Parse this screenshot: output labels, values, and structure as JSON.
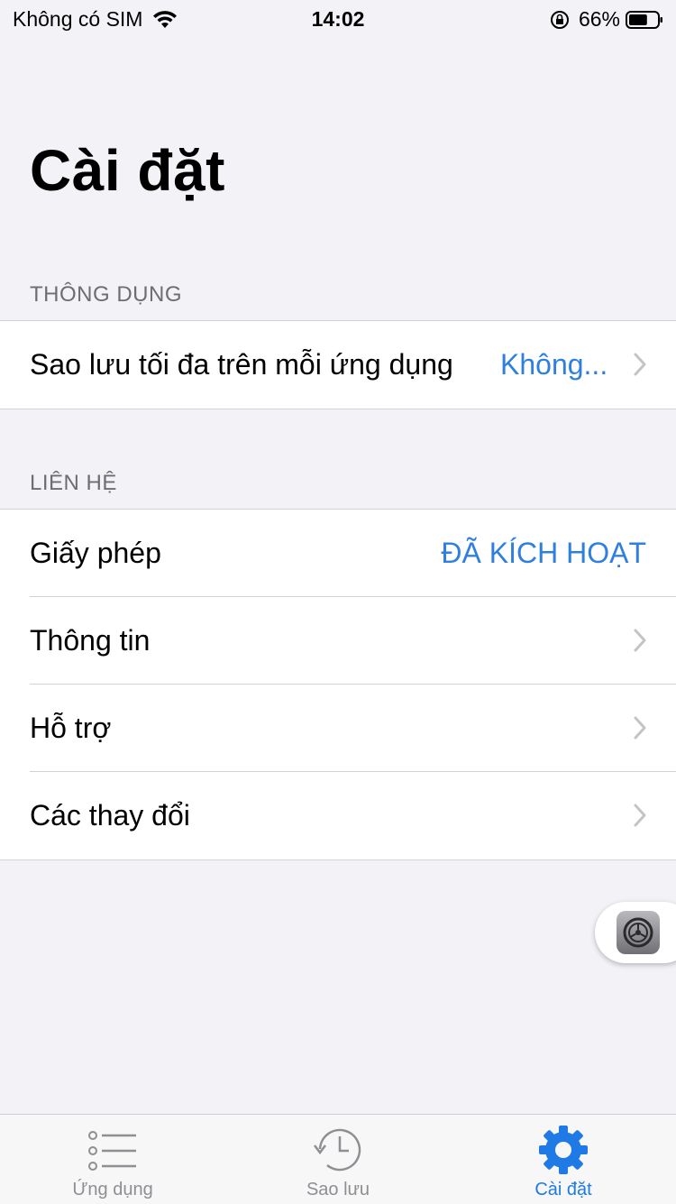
{
  "status_bar": {
    "carrier": "Không có SIM",
    "time": "14:02",
    "battery_percent": "66%",
    "battery_level": 0.66
  },
  "page": {
    "title": "Cài đặt"
  },
  "sections": [
    {
      "header": "THÔNG DỤNG",
      "rows": [
        {
          "label": "Sao lưu tối đa trên mỗi ứng dụng",
          "value": "Không...",
          "has_chevron": true
        }
      ]
    },
    {
      "header": "LIÊN HỆ",
      "rows": [
        {
          "label": "Giấy phép",
          "value": "ĐÃ KÍCH HOẠT",
          "has_chevron": false
        },
        {
          "label": "Thông tin",
          "has_chevron": true
        },
        {
          "label": "Hỗ trợ",
          "has_chevron": true
        },
        {
          "label": "Các thay đổi",
          "has_chevron": true
        }
      ]
    }
  ],
  "tab_bar": {
    "tabs": [
      {
        "label": "Ứng dụng",
        "icon": "list-icon",
        "active": false
      },
      {
        "label": "Sao lưu",
        "icon": "history-clock-icon",
        "active": false
      },
      {
        "label": "Cài đặt",
        "icon": "gear-icon",
        "active": true
      }
    ]
  },
  "colors": {
    "accent": "#1f7ae6",
    "value_text": "#2f7fe0",
    "background": "#f2f2f7",
    "secondary_text": "#6d6d72",
    "tab_inactive": "#8e8e93"
  }
}
